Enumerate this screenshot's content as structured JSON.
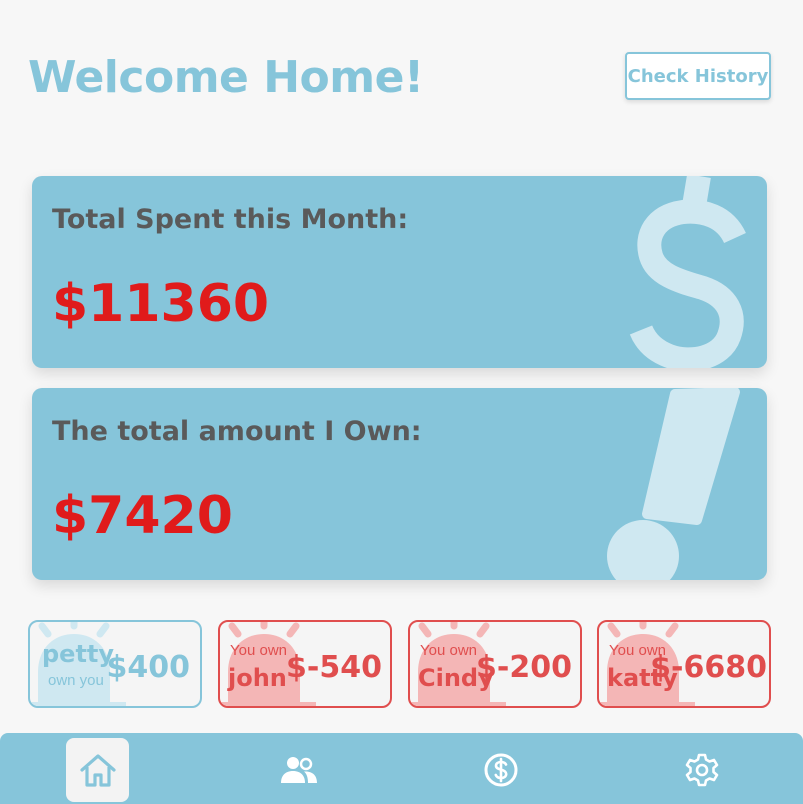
{
  "header": {
    "title": "Welcome Home!",
    "history_button": "Check History"
  },
  "cards": {
    "spent": {
      "label": "Total Spent this Month:",
      "value": "$11360",
      "icon": "dollar-sign-icon"
    },
    "owed": {
      "label": "The total amount I Own:",
      "value": "$7420",
      "icon": "exclamation-icon"
    }
  },
  "debts": [
    {
      "name": "petty",
      "caption": "own you",
      "amount": "$400",
      "direction": "owes-me",
      "icon": "alarm-icon"
    },
    {
      "name": "john",
      "caption": "You own",
      "amount": "$-540",
      "direction": "i-owe",
      "icon": "alarm-icon"
    },
    {
      "name": "Cindy",
      "caption": "You own",
      "amount": "$-200",
      "direction": "i-owe",
      "icon": "alarm-icon"
    },
    {
      "name": "katty",
      "caption": "You own",
      "amount": "$-6680",
      "direction": "i-owe",
      "icon": "alarm-icon"
    }
  ],
  "nav": [
    {
      "name": "home",
      "icon": "home-icon",
      "active": true
    },
    {
      "name": "friends",
      "icon": "users-icon",
      "active": false
    },
    {
      "name": "payments",
      "icon": "dollar-circle-icon",
      "active": false
    },
    {
      "name": "settings",
      "icon": "gear-icon",
      "active": false
    }
  ],
  "colors": {
    "accent": "#86c5da",
    "negative": "#e04e4e",
    "value_red": "#e01b1b",
    "label_gray": "#5a5a5a",
    "background": "#f7f7f7"
  }
}
